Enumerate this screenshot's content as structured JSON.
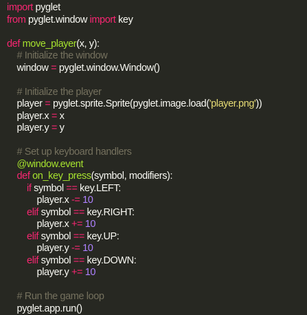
{
  "editor": {
    "lines": [
      [
        {
          "t": "import",
          "c": "kw"
        },
        {
          "t": " pyglet",
          "c": "plain"
        }
      ],
      [
        {
          "t": "from",
          "c": "kw"
        },
        {
          "t": " pyglet.window ",
          "c": "plain"
        },
        {
          "t": "import",
          "c": "kw"
        },
        {
          "t": " key",
          "c": "plain"
        }
      ],
      [],
      [
        {
          "t": "def",
          "c": "kw"
        },
        {
          "t": " ",
          "c": "plain"
        },
        {
          "t": "move_player",
          "c": "fn"
        },
        {
          "t": "(x, y):",
          "c": "plain"
        }
      ],
      [
        {
          "t": "    # Initialize the window",
          "c": "cm"
        }
      ],
      [
        {
          "t": "    window ",
          "c": "plain"
        },
        {
          "t": "=",
          "c": "op"
        },
        {
          "t": " pyglet.window.Window()",
          "c": "plain"
        }
      ],
      [],
      [
        {
          "t": "    # Initialize the player",
          "c": "cm"
        }
      ],
      [
        {
          "t": "    player ",
          "c": "plain"
        },
        {
          "t": "=",
          "c": "op"
        },
        {
          "t": " pyglet.sprite.Sprite(pyglet.image.load(",
          "c": "plain"
        },
        {
          "t": "'player.png'",
          "c": "str"
        },
        {
          "t": "))",
          "c": "plain"
        }
      ],
      [
        {
          "t": "    player.x ",
          "c": "plain"
        },
        {
          "t": "=",
          "c": "op"
        },
        {
          "t": " x",
          "c": "plain"
        }
      ],
      [
        {
          "t": "    player.y ",
          "c": "plain"
        },
        {
          "t": "=",
          "c": "op"
        },
        {
          "t": " y",
          "c": "plain"
        }
      ],
      [],
      [
        {
          "t": "    # Set up keyboard handlers",
          "c": "cm"
        }
      ],
      [
        {
          "t": "    @window.event",
          "c": "dec"
        }
      ],
      [
        {
          "t": "    ",
          "c": "plain"
        },
        {
          "t": "def",
          "c": "kw"
        },
        {
          "t": " ",
          "c": "plain"
        },
        {
          "t": "on_key_press",
          "c": "fn"
        },
        {
          "t": "(symbol, modifiers):",
          "c": "plain"
        }
      ],
      [
        {
          "t": "        ",
          "c": "plain"
        },
        {
          "t": "if",
          "c": "kw"
        },
        {
          "t": " symbol ",
          "c": "plain"
        },
        {
          "t": "==",
          "c": "op"
        },
        {
          "t": " key.LEFT:",
          "c": "plain"
        }
      ],
      [
        {
          "t": "            player.x ",
          "c": "plain"
        },
        {
          "t": "-=",
          "c": "op"
        },
        {
          "t": " ",
          "c": "plain"
        },
        {
          "t": "10",
          "c": "num"
        }
      ],
      [
        {
          "t": "        ",
          "c": "plain"
        },
        {
          "t": "elif",
          "c": "kw"
        },
        {
          "t": " symbol ",
          "c": "plain"
        },
        {
          "t": "==",
          "c": "op"
        },
        {
          "t": " key.RIGHT:",
          "c": "plain"
        }
      ],
      [
        {
          "t": "            player.x ",
          "c": "plain"
        },
        {
          "t": "+=",
          "c": "op"
        },
        {
          "t": " ",
          "c": "plain"
        },
        {
          "t": "10",
          "c": "num"
        }
      ],
      [
        {
          "t": "        ",
          "c": "plain"
        },
        {
          "t": "elif",
          "c": "kw"
        },
        {
          "t": " symbol ",
          "c": "plain"
        },
        {
          "t": "==",
          "c": "op"
        },
        {
          "t": " key.UP:",
          "c": "plain"
        }
      ],
      [
        {
          "t": "            player.y ",
          "c": "plain"
        },
        {
          "t": "-=",
          "c": "op"
        },
        {
          "t": " ",
          "c": "plain"
        },
        {
          "t": "10",
          "c": "num"
        }
      ],
      [
        {
          "t": "        ",
          "c": "plain"
        },
        {
          "t": "elif",
          "c": "kw"
        },
        {
          "t": " symbol ",
          "c": "plain"
        },
        {
          "t": "==",
          "c": "op"
        },
        {
          "t": " key.DOWN:",
          "c": "plain"
        }
      ],
      [
        {
          "t": "            player.y ",
          "c": "plain"
        },
        {
          "t": "+=",
          "c": "op"
        },
        {
          "t": " ",
          "c": "plain"
        },
        {
          "t": "10",
          "c": "num"
        }
      ],
      [],
      [
        {
          "t": "    # Run the game loop",
          "c": "cm"
        }
      ],
      [
        {
          "t": "    pyglet.app.run()",
          "c": "plain"
        }
      ]
    ]
  }
}
